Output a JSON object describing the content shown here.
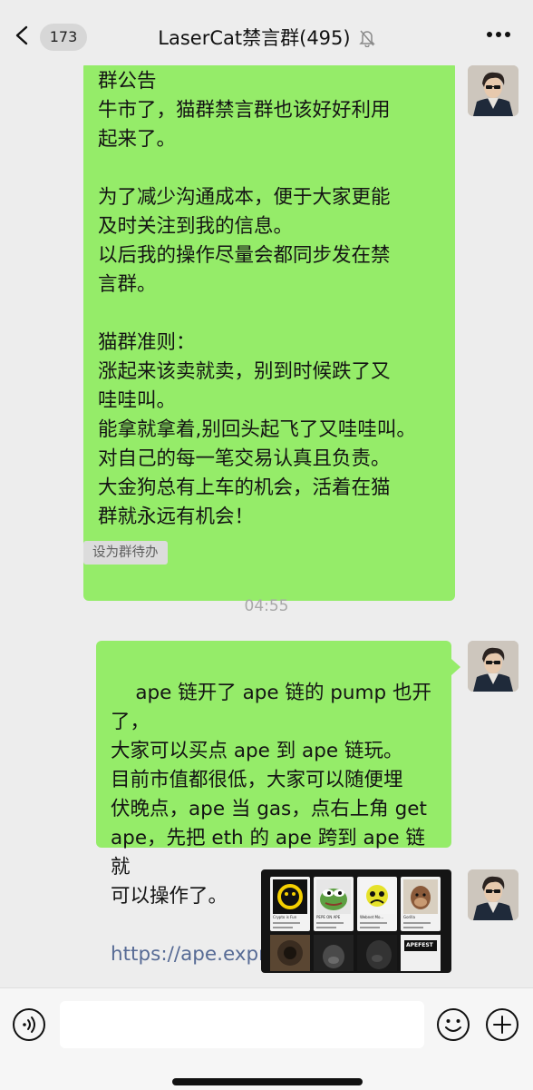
{
  "header": {
    "back_count": "173",
    "title": "LaserCat禁言群(495)"
  },
  "messages": [
    {
      "text": "群公告\n牛市了，猫群禁言群也该好好利用\n起来了。\n\n为了减少沟通成本，便于大家更能\n及时关注到我的信息。\n以后我的操作尽量会都同步发在禁\n言群。\n\n猫群准则：\n涨起来该卖就卖，别到时候跌了又\n哇哇叫。\n能拿就拿着,别回头起飞了又哇哇叫。\n对自己的每一笔交易认真且负责。\n大金狗总有上车的机会，活着在猫\n群就永远有机会！",
      "tag": "设为群待办"
    },
    {
      "timestamp": "04:55",
      "text": "ape 链开了 ape 链的 pump 也开了，\n大家可以买点 ape 到 ape 链玩。\n目前市值都很低，大家可以随便埋\n伏晚点，ape 当 gas，点右上角 get\nape，先把 eth 的 ape 跨到 ape 链就\n可以操作了。",
      "link": "https://ape.express/"
    },
    {
      "image": {
        "cards": [
          {
            "name": "Crypto is Fun"
          },
          {
            "name": "PEPE ON APE"
          },
          {
            "name": "Webnet Mo..."
          },
          {
            "name": "Gorilla"
          }
        ],
        "badge": "APEFEST"
      }
    }
  ],
  "input": {
    "placeholder": ""
  },
  "colors": {
    "background": "#ededed",
    "bubble": "#95ec69",
    "link": "#576b95",
    "timestamp": "#a8a8a8"
  },
  "icons": [
    "back-chevron-icon",
    "mute-bell-icon",
    "more-dots-icon",
    "voice-icon",
    "emoji-icon",
    "plus-icon"
  ]
}
